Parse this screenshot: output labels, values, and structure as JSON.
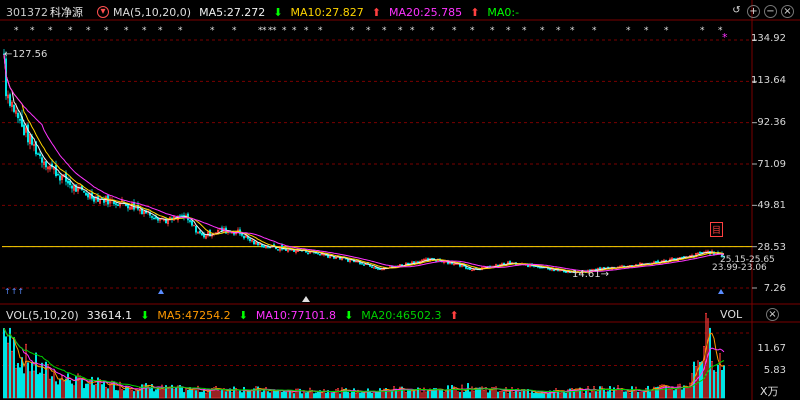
{
  "header": {
    "code": "301372",
    "name": "科净源",
    "ma_label": "MA(5,10,20,0)",
    "ma5": "MA5:27.272",
    "ma10": "MA10:27.827",
    "ma20": "MA20:25.785",
    "ma0": "MA0:-",
    "arrow_down": "⬇",
    "arrow_up": "⬆"
  },
  "colors": {
    "up": "#ff3b3b",
    "down": "#00e5e5",
    "ma5": "#f0f0f0",
    "ma10": "#ffd400",
    "ma20": "#ff33ff",
    "ma0": "#00ff00",
    "grid": "#7a0000",
    "price_line": "#ffd400",
    "vol_ma5": "#ff9900",
    "vol_ma10": "#ff33ff",
    "vol_ma20": "#00d000"
  },
  "price_axis": [
    "134.92",
    "113.64",
    "92.36",
    "71.09",
    "49.81",
    "28.53",
    "7.26"
  ],
  "annotations": {
    "high": "127.56",
    "low": "14.61",
    "mid_label_1": "25.15",
    "mid_label_2": "25.65",
    "mid_label_3": "23.99",
    "mid_label_4": "23.06",
    "badge": "目",
    "left_marks": "↑↑↑"
  },
  "volume": {
    "label": "VOL(5,10,20)",
    "value": "33614.1",
    "ma5": "MA5:47254.2",
    "ma10": "MA10:77101.8",
    "ma20": "MA20:46502.3",
    "axis_label": "VOL",
    "axis_ticks": [
      "11.67",
      "5.83"
    ],
    "unit": "X万"
  },
  "buttons": {
    "back": "↺",
    "zoom_in": "+",
    "zoom_out": "−",
    "close": "×"
  },
  "chart_data": {
    "type": "candlestick",
    "price_ylim": [
      7.26,
      134.92
    ],
    "price_ticks": [
      134.92,
      113.64,
      92.36,
      71.09,
      49.81,
      28.53,
      7.26
    ],
    "labeled_high": 127.56,
    "labeled_low": 14.61,
    "reference_level": 28.53,
    "volume_ticks": [
      11.67,
      5.83
    ],
    "close_trend": [
      112,
      90,
      75,
      66,
      58,
      54,
      52,
      50,
      46,
      42,
      44,
      34,
      37,
      36,
      30,
      28,
      27,
      26,
      24,
      22,
      20,
      17,
      19,
      21,
      22,
      20,
      17,
      18,
      20,
      19,
      18,
      16,
      15,
      17,
      18,
      19,
      20,
      22,
      23,
      26,
      24
    ],
    "volume_trend": [
      10,
      7,
      5,
      3.5,
      3,
      2.5,
      2.2,
      2,
      1.8,
      1.6,
      1.5,
      1.4,
      1.5,
      1.6,
      1.4,
      1.2,
      1.1,
      1.2,
      1.3,
      1.2,
      1.1,
      1.3,
      1.6,
      1.4,
      1.3,
      1.6,
      1.8,
      1.5,
      1.3,
      1.2,
      1.1,
      1.2,
      1.3,
      1.5,
      1.6,
      1.4,
      1.5,
      1.7,
      2.2,
      10.5,
      5
    ]
  }
}
